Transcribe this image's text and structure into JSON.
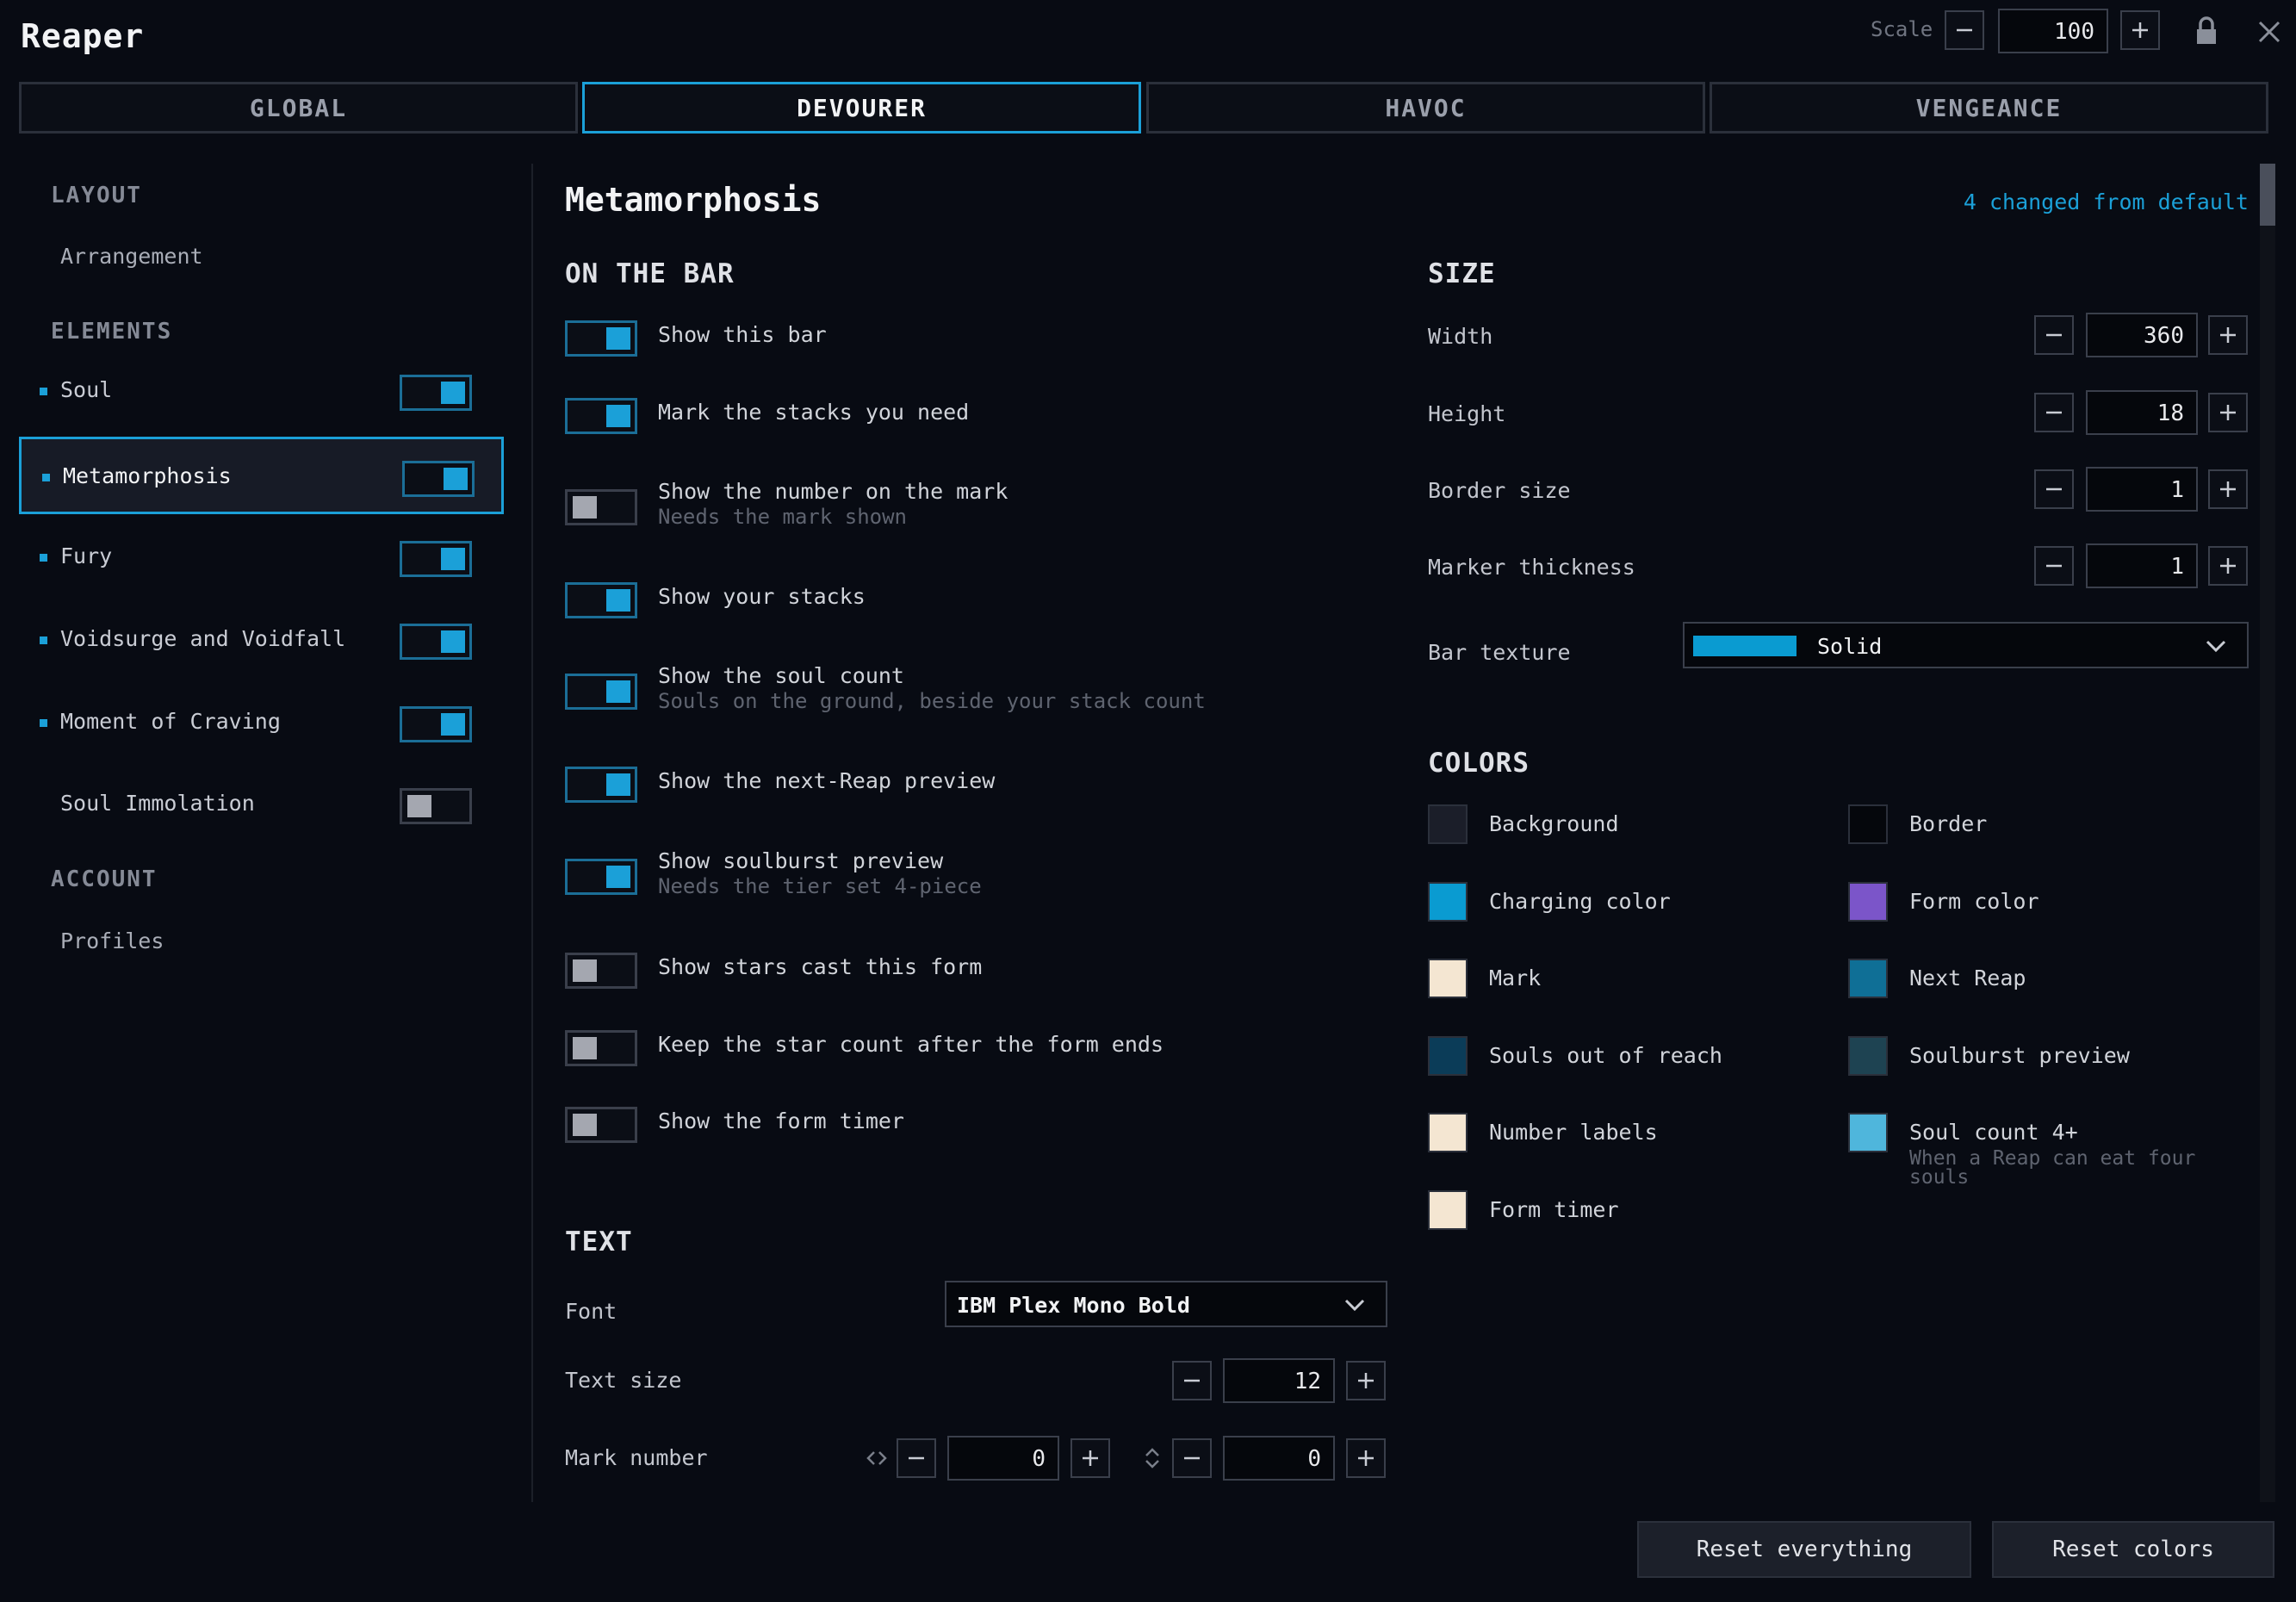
{
  "app": {
    "title": "Reaper"
  },
  "scale": {
    "label": "Scale",
    "value": "100"
  },
  "tabs": [
    {
      "label": "GLOBAL",
      "active": false
    },
    {
      "label": "DEVOURER",
      "active": true
    },
    {
      "label": "HAVOC",
      "active": false
    },
    {
      "label": "VENGEANCE",
      "active": false
    }
  ],
  "sidebar": {
    "layout_heading": "LAYOUT",
    "arrangement": "Arrangement",
    "elements_heading": "ELEMENTS",
    "elements": [
      {
        "label": "Soul",
        "enabled": true,
        "selected": false,
        "dot": true
      },
      {
        "label": "Metamorphosis",
        "enabled": true,
        "selected": true,
        "dot": true
      },
      {
        "label": "Fury",
        "enabled": true,
        "selected": false,
        "dot": true
      },
      {
        "label": "Voidsurge and Voidfall",
        "enabled": true,
        "selected": false,
        "dot": true
      },
      {
        "label": "Moment of Craving",
        "enabled": true,
        "selected": false,
        "dot": true
      },
      {
        "label": "Soul Immolation",
        "enabled": false,
        "selected": false,
        "dot": false
      }
    ],
    "account_heading": "ACCOUNT",
    "profiles": "Profiles"
  },
  "main": {
    "title": "Metamorphosis",
    "changed_note": "4 changed from default",
    "on_the_bar": {
      "heading": "ON THE BAR",
      "options": [
        {
          "label": "Show this bar",
          "sub": "",
          "on": true
        },
        {
          "label": "Mark the stacks you need",
          "sub": "",
          "on": true
        },
        {
          "label": "Show the number on the mark",
          "sub": "Needs the mark shown",
          "on": false
        },
        {
          "label": "Show your stacks",
          "sub": "",
          "on": true
        },
        {
          "label": "Show the soul count",
          "sub": "Souls on the ground, beside your stack count",
          "on": true
        },
        {
          "label": "Show the next-Reap preview",
          "sub": "",
          "on": true
        },
        {
          "label": "Show soulburst preview",
          "sub": "Needs the tier set 4-piece",
          "on": true
        },
        {
          "label": "Show stars cast this form",
          "sub": "",
          "on": false
        },
        {
          "label": "Keep the star count after the form ends",
          "sub": "",
          "on": false
        },
        {
          "label": "Show the form timer",
          "sub": "",
          "on": false
        }
      ]
    },
    "text": {
      "heading": "TEXT",
      "font_label": "Font",
      "font_value": "IBM Plex Mono Bold",
      "text_size_label": "Text size",
      "text_size_value": "12",
      "mark_number_label": "Mark number",
      "mark_number_x": "0",
      "mark_number_y": "0"
    },
    "size": {
      "heading": "SIZE",
      "rows": [
        {
          "label": "Width",
          "value": "360"
        },
        {
          "label": "Height",
          "value": "18"
        },
        {
          "label": "Border size",
          "value": "1"
        },
        {
          "label": "Marker thickness",
          "value": "1"
        }
      ],
      "bar_texture_label": "Bar texture",
      "bar_texture_value": "Solid",
      "bar_texture_color": "#0a9bd1"
    },
    "colors": {
      "heading": "COLORS",
      "items": [
        {
          "label": "Background",
          "sub": "",
          "color": "#1b1e29"
        },
        {
          "label": "Border",
          "sub": "",
          "color": "#05070c"
        },
        {
          "label": "Charging color",
          "sub": "",
          "color": "#0a9bd1"
        },
        {
          "label": "Form color",
          "sub": "",
          "color": "#7b55c9"
        },
        {
          "label": "Mark",
          "sub": "",
          "color": "#f4e6d2"
        },
        {
          "label": "Next Reap",
          "sub": "",
          "color": "#0f6f96"
        },
        {
          "label": "Souls out of reach",
          "sub": "",
          "color": "#0b3c58"
        },
        {
          "label": "Soulburst preview",
          "sub": "",
          "color": "#1e4352"
        },
        {
          "label": "Number labels",
          "sub": "",
          "color": "#f4e6d2"
        },
        {
          "label": "Soul count 4+",
          "sub": "When a Reap can eat four souls",
          "color": "#4fb6dc"
        },
        {
          "label": "Form timer",
          "sub": "",
          "color": "#f4e6d2"
        }
      ]
    }
  },
  "footer": {
    "reset_everything": "Reset everything",
    "reset_colors": "Reset colors"
  },
  "theme": {
    "accent": "#1ba0d8",
    "background": "#080b13"
  }
}
